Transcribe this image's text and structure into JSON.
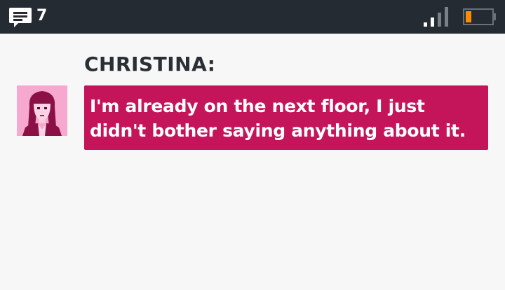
{
  "status_bar": {
    "message_count": "7",
    "message_icon": "chat-bubble-icon",
    "signal_icon": "signal-strength-icon",
    "battery_icon": "battery-low-icon"
  },
  "conversation": {
    "speaker": "CHRISTINA:",
    "message": "I'm already on the next floor, I just didn't bother saying anything about it.",
    "avatar_icon": "christina-portrait"
  },
  "colors": {
    "status_bar_bg": "#252b33",
    "background": "#f7f7f7",
    "bubble_bg": "#c4155a",
    "avatar_bg": "#f6a8ce",
    "battery_level": "#ff8c00"
  }
}
